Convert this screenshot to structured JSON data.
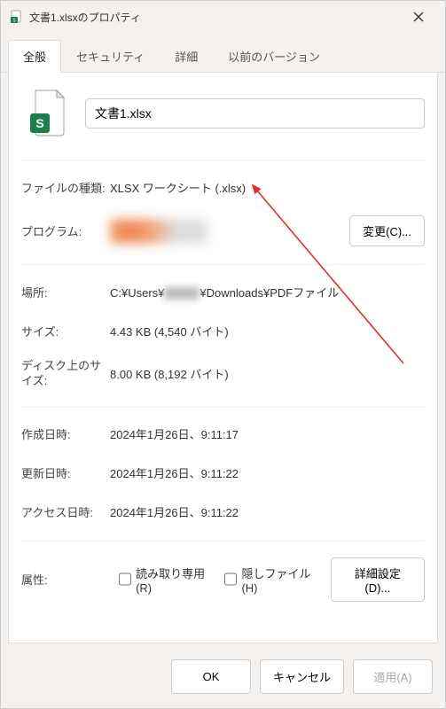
{
  "titlebar": {
    "title": "文書1.xlsxのプロパティ"
  },
  "tabs": [
    {
      "label": "全般",
      "active": true
    },
    {
      "label": "セキュリティ",
      "active": false
    },
    {
      "label": "詳細",
      "active": false
    },
    {
      "label": "以前のバージョン",
      "active": false
    }
  ],
  "filename": "文書1.xlsx",
  "props": {
    "filetype_label": "ファイルの種類:",
    "filetype_value": "XLSX ワークシート (.xlsx)",
    "program_label": "プログラム:",
    "change_button": "変更(C)...",
    "location_label": "場所:",
    "location_prefix": "C:¥Users¥",
    "location_suffix": "¥Downloads¥PDFファイル",
    "size_label": "サイズ:",
    "size_value": "4.43 KB (4,540 バイト)",
    "disksize_label": "ディスク上のサイズ:",
    "disksize_value": "8.00 KB (8,192 バイト)",
    "created_label": "作成日時:",
    "created_value": "2024年1月26日、9:11:17",
    "modified_label": "更新日時:",
    "modified_value": "2024年1月26日、9:11:22",
    "accessed_label": "アクセス日時:",
    "accessed_value": "2024年1月26日、9:11:22",
    "attr_label": "属性:",
    "readonly_label": "読み取り専用(R)",
    "hidden_label": "隠しファイル(H)",
    "advanced_button": "詳細設定(D)..."
  },
  "footer": {
    "ok": "OK",
    "cancel": "キャンセル",
    "apply": "適用(A)"
  }
}
